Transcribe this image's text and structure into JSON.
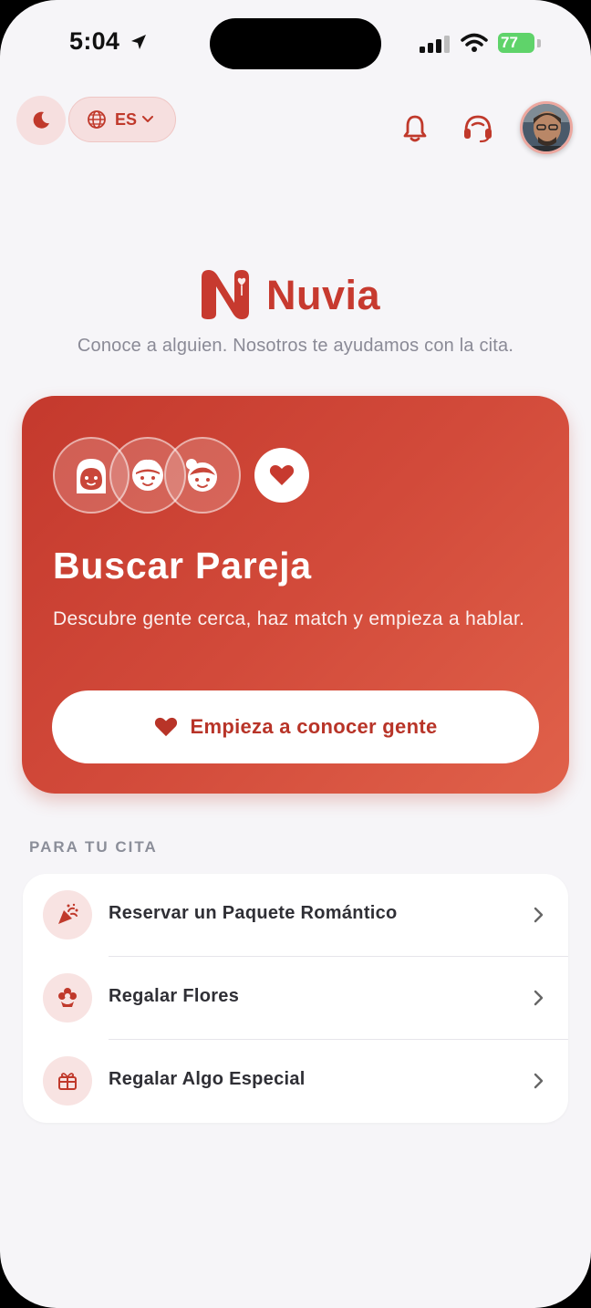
{
  "status_bar": {
    "time": "5:04",
    "battery": "77"
  },
  "header": {
    "language": "ES",
    "icons": [
      "moon-icon",
      "globe-icon",
      "chevron-down-icon",
      "bell-icon",
      "headset-icon",
      "avatar"
    ]
  },
  "brand": {
    "name": "Nuvia",
    "tagline": "Conoce a alguien. Nosotros te ayudamos con la cita."
  },
  "hero": {
    "title": "Buscar Pareja",
    "subtitle": "Descubre gente cerca, haz match y empieza a hablar.",
    "cta": "Empieza a conocer gente"
  },
  "date_section": {
    "title": "PARA TU CITA",
    "items": [
      {
        "label": "Reservar un Paquete Romántico",
        "icon": "party-popper-icon"
      },
      {
        "label": "Regalar Flores",
        "icon": "flower-icon"
      },
      {
        "label": "Regalar Algo Especial",
        "icon": "gift-icon"
      }
    ]
  },
  "colors": {
    "accent": "#c73a2f",
    "accent_light": "#f6dfdf",
    "background": "#f6f5f8"
  }
}
